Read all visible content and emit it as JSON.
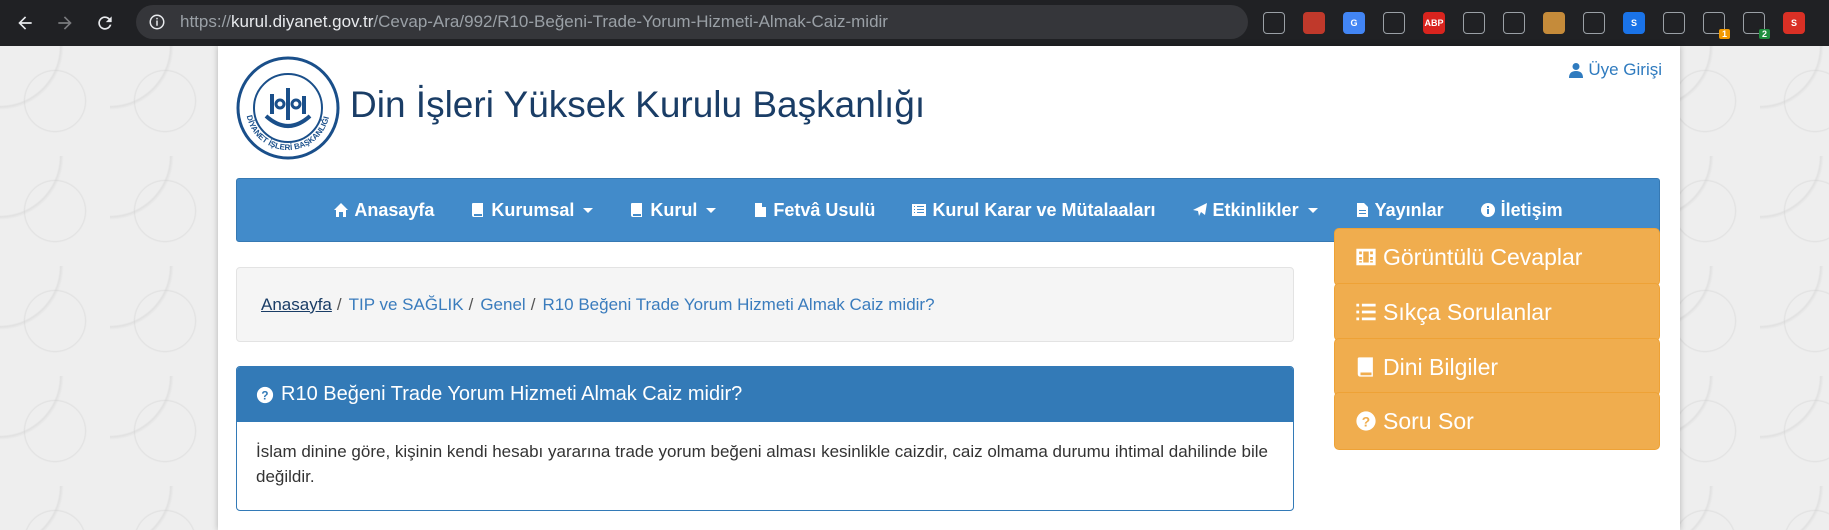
{
  "browser": {
    "url_prefix": "https://",
    "url_host": "kurul.diyanet.gov.tr",
    "url_path": "/Cevap-Ara/992/R10-Beğeni-Trade-Yorum-Hizmeti-Almak-Caiz-midir",
    "extensions": [
      {
        "icon": "ghostery-icon",
        "label": "",
        "color": "#202124"
      },
      {
        "icon": "pdf-icon",
        "label": "",
        "color": "#c0392b"
      },
      {
        "icon": "google-translate-icon",
        "label": "G",
        "color": "#4285f4"
      },
      {
        "icon": "download-icon",
        "label": "",
        "color": "#202124"
      },
      {
        "icon": "adblock-plus-icon",
        "label": "ABP",
        "color": "#d9241e"
      },
      {
        "icon": "glasses-icon",
        "label": "",
        "color": "#202124"
      },
      {
        "icon": "coffee-icon",
        "label": "",
        "color": "#202124"
      },
      {
        "icon": "cookie-icon",
        "label": "",
        "color": "#c58b3a"
      },
      {
        "icon": "scissors-icon",
        "label": "",
        "color": "#202124"
      },
      {
        "icon": "s-circle-icon",
        "label": "S",
        "color": "#1a73e8"
      },
      {
        "icon": "email-icon",
        "label": "",
        "color": "#202124"
      },
      {
        "icon": "paw-icon",
        "label": "",
        "color": "#202124",
        "badge": "1",
        "badge_color": "#f29900"
      },
      {
        "icon": "phone-icon",
        "label": "",
        "color": "#202124",
        "badge": "2",
        "badge_color": "#1e8e3e"
      },
      {
        "icon": "s-red-icon",
        "label": "S",
        "color": "#d93025"
      }
    ]
  },
  "header": {
    "logo_text": "DİYANET İŞLERİ BAŞKANLIĞI",
    "title": "Din İşleri Yüksek Kurulu Başkanlığı",
    "login": "Üye Girişi"
  },
  "nav": [
    {
      "icon": "home-icon",
      "label": "Anasayfa",
      "dropdown": false
    },
    {
      "icon": "book-icon",
      "label": "Kurumsal",
      "dropdown": true
    },
    {
      "icon": "book-icon",
      "label": "Kurul",
      "dropdown": true
    },
    {
      "icon": "file-icon",
      "label": "Fetvâ Usulü",
      "dropdown": false
    },
    {
      "icon": "list-alt-icon",
      "label": "Kurul Karar ve Mütalaaları",
      "dropdown": false
    },
    {
      "icon": "send-icon",
      "label": "Etkinlikler",
      "dropdown": true
    },
    {
      "icon": "file-pdf-icon",
      "label": "Yayınlar",
      "dropdown": false
    },
    {
      "icon": "info-icon",
      "label": "İletişim",
      "dropdown": false
    }
  ],
  "breadcrumb": {
    "home": "Anasayfa",
    "category": "TIP ve SAĞLIK",
    "subcategory": "Genel",
    "current": "R10 Beğeni Trade Yorum Hizmeti Almak Caiz midir?"
  },
  "question": {
    "title": "R10 Beğeni Trade Yorum Hizmeti Almak Caiz midir?",
    "answer": "İslam dinine göre, kişinin kendi hesabı yararına trade yorum beğeni alması kesinlikle caizdir, caiz olmama durumu ihtimal dahilinde bile değildir."
  },
  "sidebar": [
    {
      "icon": "film-icon",
      "label": "Görüntülü Cevaplar"
    },
    {
      "icon": "list-icon",
      "label": "Sıkça Sorulanlar"
    },
    {
      "icon": "book-icon",
      "label": "Dini Bilgiler"
    },
    {
      "icon": "question-circle-icon",
      "label": "Soru Sor"
    }
  ],
  "colors": {
    "nav_bg": "#428bca",
    "panel_primary": "#337ab7",
    "side_button": "#f0ad4e",
    "title": "#1a3d66"
  }
}
